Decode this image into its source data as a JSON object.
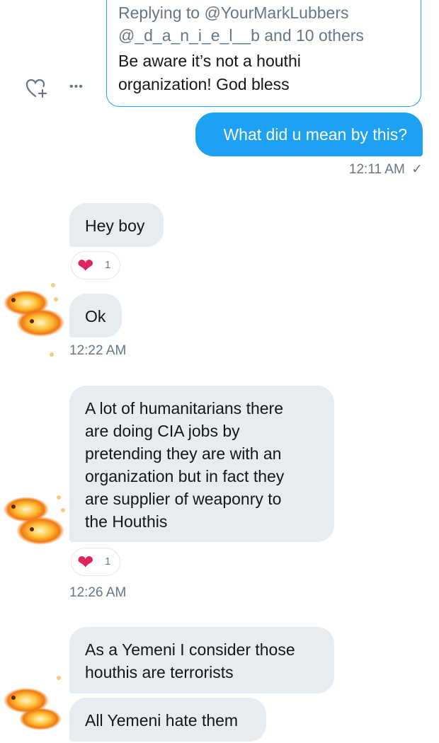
{
  "quoted_tweet": {
    "reply_line1": "Replying to @YourMarkLubbers",
    "reply_line2": "@_d_a_n_i_e_l__b and 10 others",
    "text_line1": "Be aware it’s not a houthi",
    "text_line2": "organization! God bless",
    "accent_color": "#1da1f2"
  },
  "actions": {
    "heart_add_icon": "heart-add-icon",
    "more_icon": "more-icon",
    "more_glyph": "•••"
  },
  "sent": {
    "text": "What did u mean by this?",
    "time": "12:11 AM",
    "status_glyph": "✓",
    "color": "#1da1f2"
  },
  "received": [
    {
      "text": "Hey boy",
      "reaction": {
        "glyph": "❤",
        "count": "1"
      }
    },
    {
      "text": "Ok",
      "time": "12:22 AM"
    },
    {
      "lines": [
        "A lot of humanitarians there",
        "are doing CIA jobs by",
        "pretending they are with an",
        "organization but in fact they",
        "are supplier of weaponry to",
        "the Houthis"
      ],
      "reaction": {
        "glyph": "❤",
        "count": "1"
      },
      "time": "12:26 AM"
    },
    {
      "lines": [
        "As a Yemeni I consider those",
        "houthis are terrorists"
      ]
    },
    {
      "text": "All Yemeni hate them"
    }
  ],
  "avatar": {
    "icon": "fire-fish-avatar"
  },
  "colors": {
    "received_bubble": "#e6ecf0",
    "muted": "#657786",
    "heart": "#e0245e"
  }
}
